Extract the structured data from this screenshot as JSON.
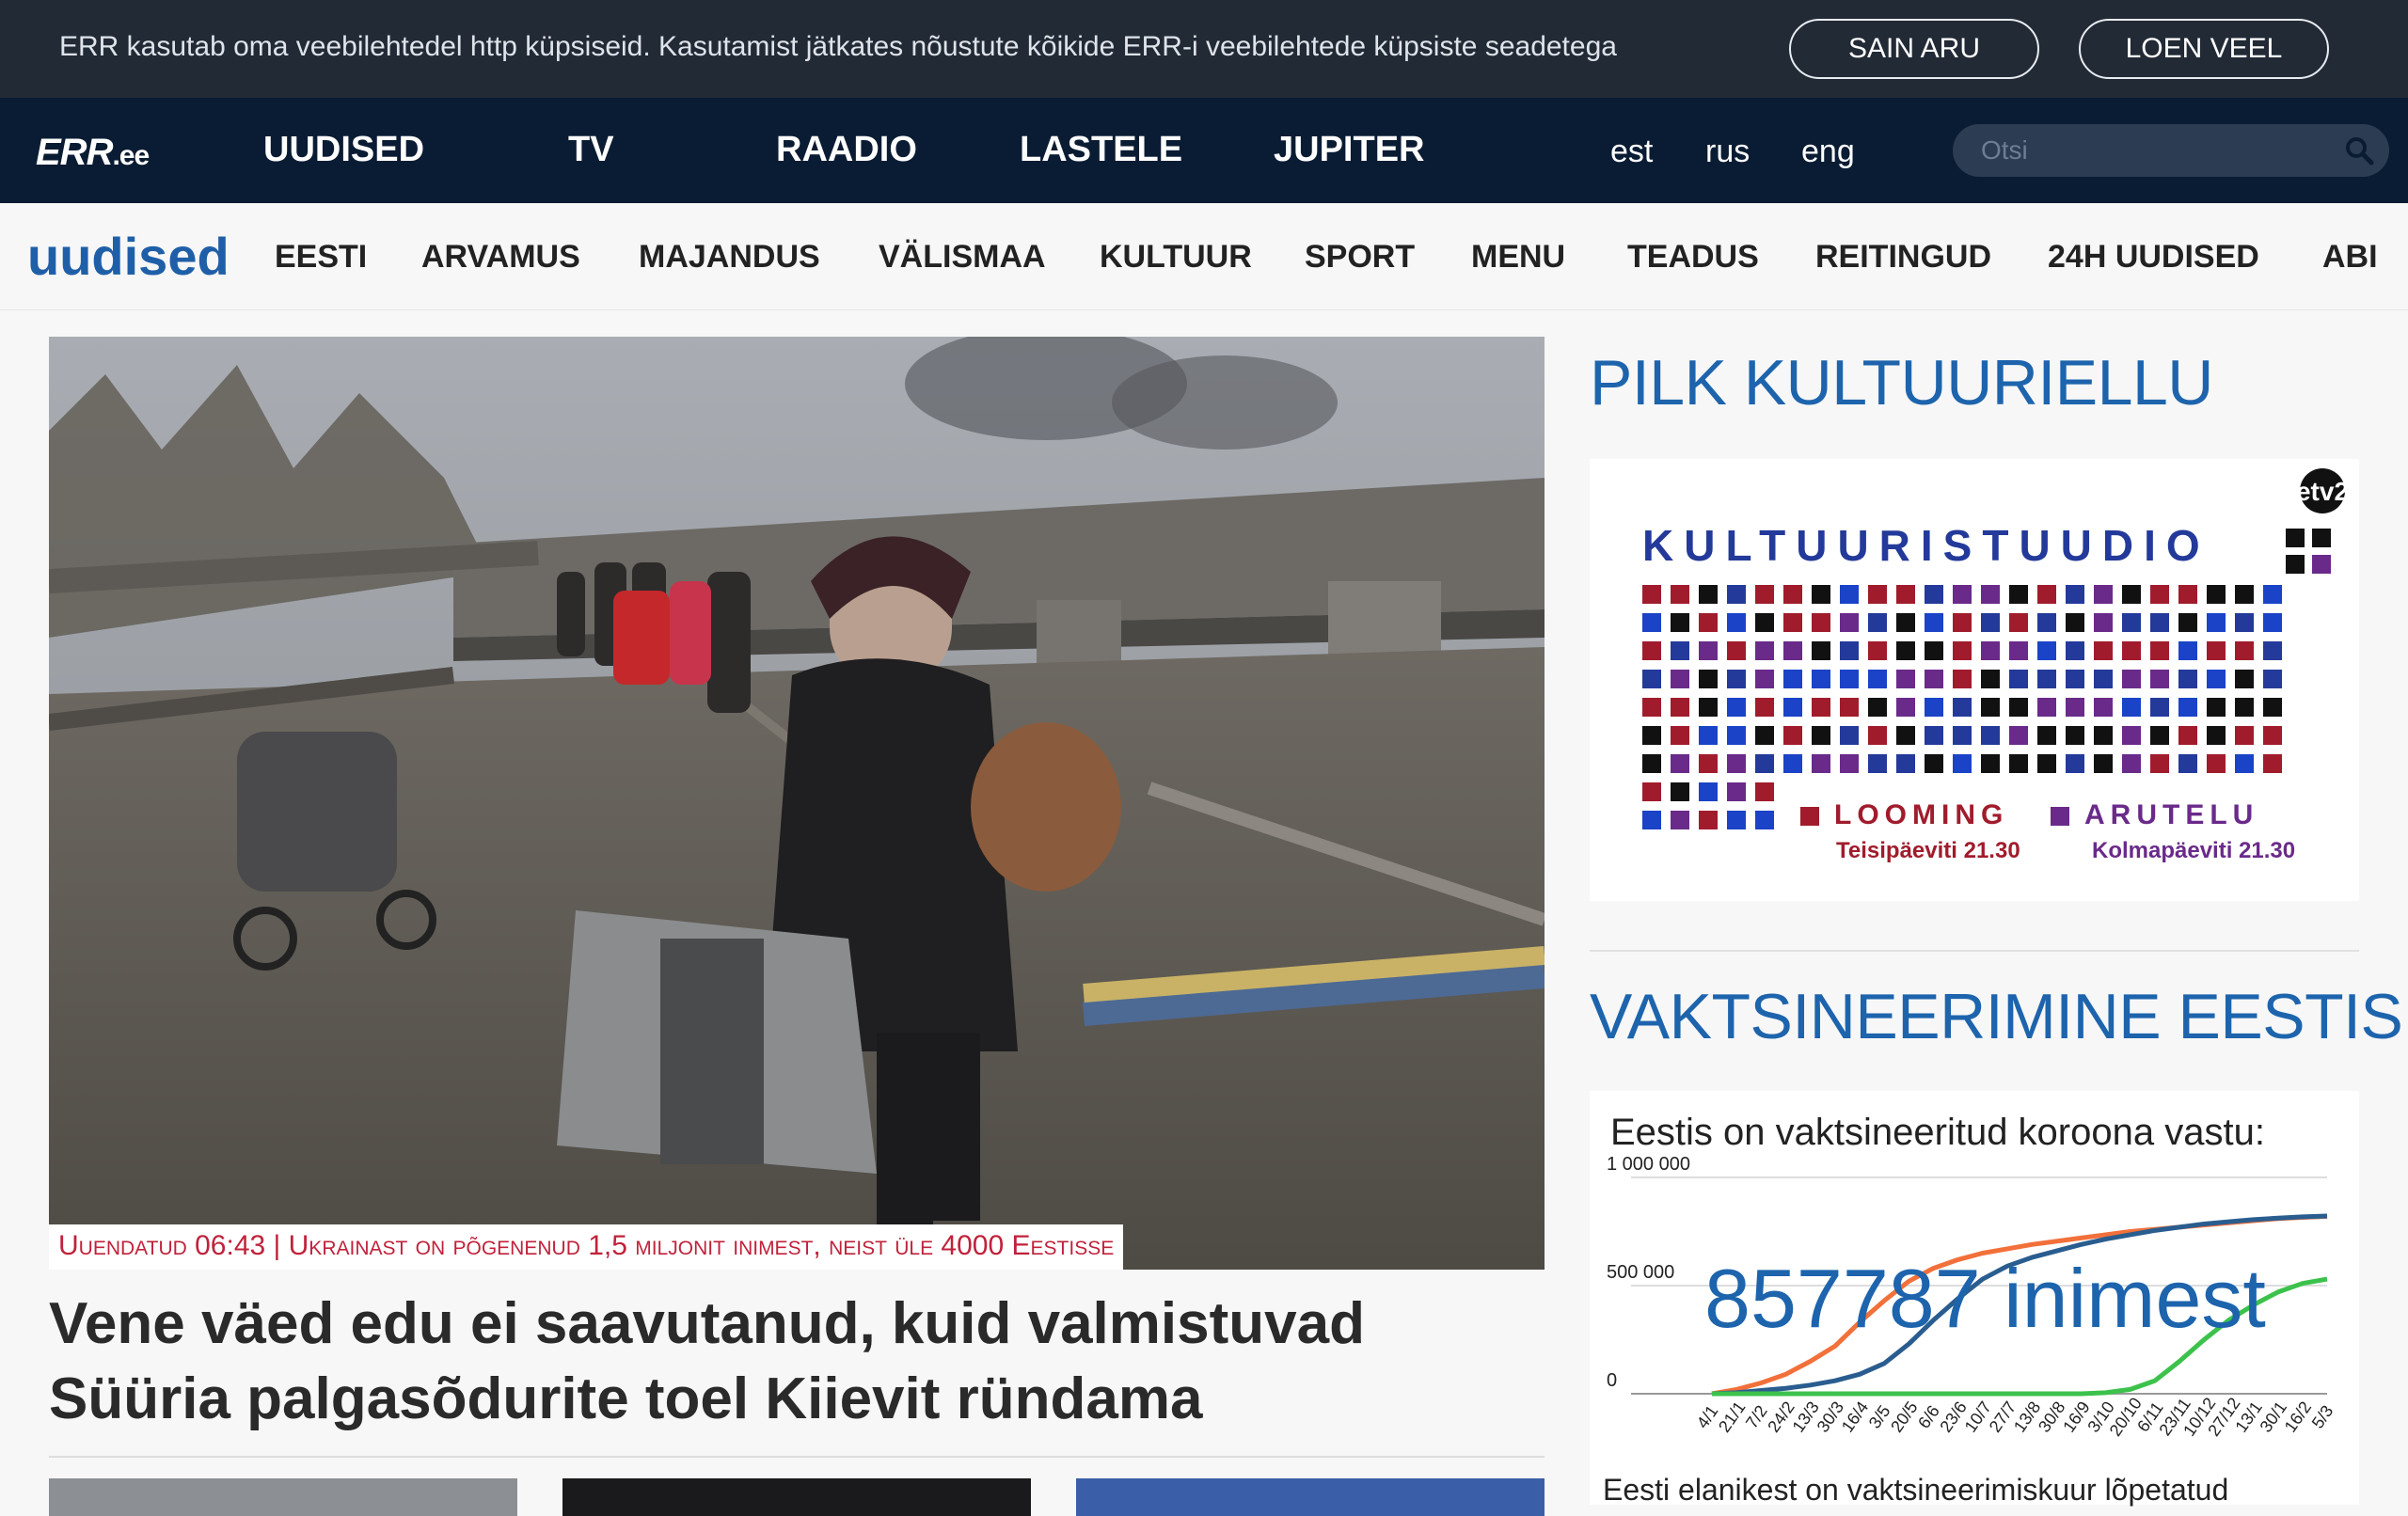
{
  "cookie": {
    "text": "ERR kasutab oma veebilehtedel http küpsiseid. Kasutamist jätkates nõustute kõikide ERR-i veebilehtede küpsiste seadetega",
    "accept_label": "SAIN ARU",
    "more_label": "LOEN VEEL"
  },
  "topnav": {
    "logo": "ERR",
    "logo_suffix": ".ee",
    "items": [
      "UUDISED",
      "TV",
      "RAADIO",
      "LASTELE",
      "JUPITER"
    ],
    "langs": [
      "est",
      "rus",
      "eng"
    ],
    "search_placeholder": "Otsi"
  },
  "secnav": {
    "brand": "uudised",
    "items": [
      "EESTI",
      "ARVAMUS",
      "MAJANDUS",
      "VÄLISMAA",
      "KULTUUR",
      "SPORT",
      "MENU",
      "TEADUS",
      "REITINGUD",
      "24H UUDISED",
      "ABI"
    ]
  },
  "main": {
    "caption": "Uuendatud 06:43 | Ukrainast on põgenenud 1,5 miljonit inimest, neist üle 4000 Eestisse",
    "headline_line1": "Vene väed edu ei saavutanud, kuid valmistuvad",
    "headline_line2": "Süüria palgasõdurite toel Kiievit ründama"
  },
  "sidebar": {
    "culture_title": "PILK KULTUURIELLU",
    "banner": {
      "title": "KULTUURISTUUDIO",
      "channel": "etv2",
      "show1": "LOOMING",
      "show1_time": "Teisipäeviti 21.30",
      "show2": "ARUTELU",
      "show2_time": "Kolmapäeviti 21.30"
    },
    "vacc_title": "VAKTSINEERIMINE EESTIS",
    "chart_heading": "Eestis on vaktsineeritud koroona vastu:",
    "chart_big": "857787 inimest",
    "chart_footer": "Eesti elanikest on vaktsineerimiskuur lõpetatud"
  },
  "chart_data": {
    "type": "line",
    "ylim": [
      0,
      1000000
    ],
    "y_ticks": [
      "1 000 000",
      "500 000",
      "0"
    ],
    "x_ticks": [
      "4/1",
      "21/1",
      "7/2",
      "24/2",
      "13/3",
      "30/3",
      "16/4",
      "3/5",
      "20/5",
      "6/6",
      "23/6",
      "10/7",
      "27/7",
      "13/8",
      "30/8",
      "16/9",
      "3/10",
      "20/10",
      "6/11",
      "23/11",
      "10/12",
      "27/12",
      "13/1",
      "30/1",
      "16/2",
      "5/3"
    ],
    "series": [
      {
        "color": "#f2703a",
        "values": [
          0,
          20000,
          50000,
          90000,
          150000,
          220000,
          330000,
          430000,
          520000,
          580000,
          620000,
          650000,
          670000,
          690000,
          705000,
          720000,
          735000,
          750000,
          760000,
          770000,
          780000,
          790000,
          800000,
          810000,
          815000,
          820000
        ]
      },
      {
        "color": "#2a5d8f",
        "values": [
          0,
          5000,
          15000,
          25000,
          40000,
          60000,
          90000,
          140000,
          230000,
          340000,
          440000,
          530000,
          590000,
          630000,
          660000,
          690000,
          715000,
          735000,
          755000,
          770000,
          785000,
          795000,
          805000,
          812000,
          818000,
          822000
        ]
      },
      {
        "color": "#3cc24c",
        "values": [
          0,
          0,
          0,
          0,
          0,
          0,
          0,
          0,
          0,
          0,
          0,
          0,
          0,
          0,
          0,
          0,
          5000,
          20000,
          60000,
          150000,
          250000,
          340000,
          410000,
          470000,
          510000,
          530000
        ]
      }
    ]
  }
}
